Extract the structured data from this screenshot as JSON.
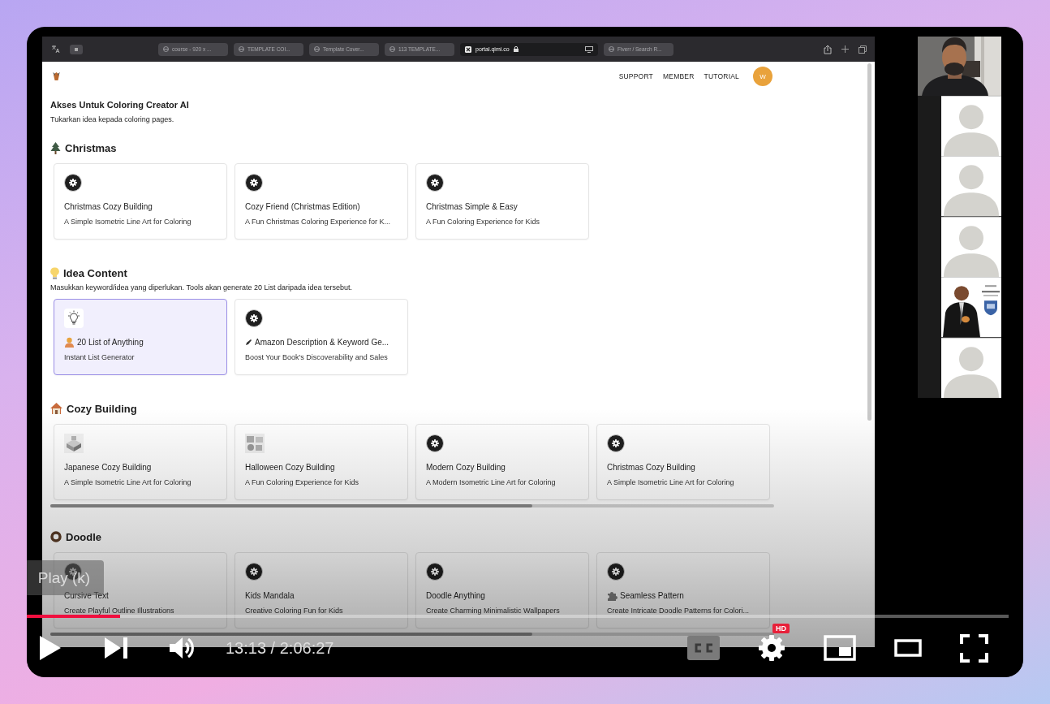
{
  "browser": {
    "tabs": [
      {
        "kind": "tab",
        "label": "course - 920 x ...",
        "selected": false
      },
      {
        "kind": "tab",
        "label": "TEMPLATE COI...",
        "selected": false
      },
      {
        "kind": "tab",
        "label": "Template Cover...",
        "selected": false
      },
      {
        "kind": "tab",
        "label": "113 TEMPLATE...",
        "selected": false
      },
      {
        "kind": "address",
        "label": "portal.qimi.co",
        "selected": true
      },
      {
        "kind": "tab",
        "label": "Fiverr / Search R...",
        "selected": false
      }
    ]
  },
  "site": {
    "nav": [
      "SUPPORT",
      "MEMBER",
      "TUTORIAL"
    ],
    "avatar": "W",
    "title": "Akses Untuk Coloring Creator AI",
    "subtitle": "Tukarkan idea kepada coloring pages.",
    "sections": [
      {
        "title": "Christmas",
        "scrollbar": false,
        "cards": [
          {
            "kind": "gear",
            "title": "Christmas Cozy Building",
            "description": "A Simple Isometric Line Art for Coloring",
            "selected": false
          },
          {
            "kind": "gear",
            "title": "Cozy Friend (Christmas Edition)",
            "description": "A Fun Christmas Coloring Experience for K...",
            "selected": false
          },
          {
            "kind": "gear",
            "title": "Christmas Simple & Easy",
            "description": "A Fun Coloring Experience for Kids",
            "selected": false
          }
        ]
      },
      {
        "title": "Idea Content",
        "description": "Masukkan keyword/idea yang diperlukan. Tools akan generate 20 List daripada idea tersebut.",
        "scrollbar": false,
        "cards": [
          {
            "kind": "bulb",
            "title": "20 List of Anything",
            "description": "Instant List Generator",
            "selected": true
          },
          {
            "kind": "gear",
            "title": "Amazon Description & Keyword Ge...",
            "description": "Boost Your Book's Discoverability and Sales",
            "selected": false
          }
        ]
      },
      {
        "title": "Cozy Building",
        "scrollbar": true,
        "cards": [
          {
            "kind": "picture",
            "title": "Japanese Cozy Building",
            "description": "A Simple Isometric Line Art for Coloring",
            "selected": false
          },
          {
            "kind": "picture",
            "title": "Halloween Cozy Building",
            "description": "A Fun Coloring Experience for Kids",
            "selected": false
          },
          {
            "kind": "gear",
            "title": "Modern Cozy Building",
            "description": "A Modern Isometric Line Art for Coloring",
            "selected": false
          },
          {
            "kind": "gear",
            "title": "Christmas Cozy Building",
            "description": "A Simple Isometric Line Art for Coloring",
            "selected": false
          }
        ]
      },
      {
        "title": "Doodle",
        "scrollbar": true,
        "cards": [
          {
            "kind": "gear",
            "title": "Cursive Text",
            "description": "Create Playful Outline Illustrations",
            "selected": false
          },
          {
            "kind": "gear",
            "title": "Kids Mandala",
            "description": "Creative Coloring Fun for Kids",
            "selected": false
          },
          {
            "kind": "gear",
            "title": "Doodle Anything",
            "description": "Create Charming Minimalistic Wallpapers",
            "selected": false
          },
          {
            "kind": "gear",
            "title": "Seamless Pattern",
            "description": "Create Intricate Doodle Patterns for Colori...",
            "selected": false
          }
        ]
      }
    ]
  },
  "participants": [
    {
      "kind": "picture"
    },
    {
      "kind": "avatar"
    },
    {
      "kind": "avatar"
    },
    {
      "kind": "avatar"
    },
    {
      "kind": "picture"
    },
    {
      "kind": "avatar"
    }
  ],
  "player": {
    "tooltip": "Play (k)",
    "progress": {
      "level": 0.095
    },
    "time": "13:13 / 2:06:27",
    "hd_badge": "HD"
  }
}
